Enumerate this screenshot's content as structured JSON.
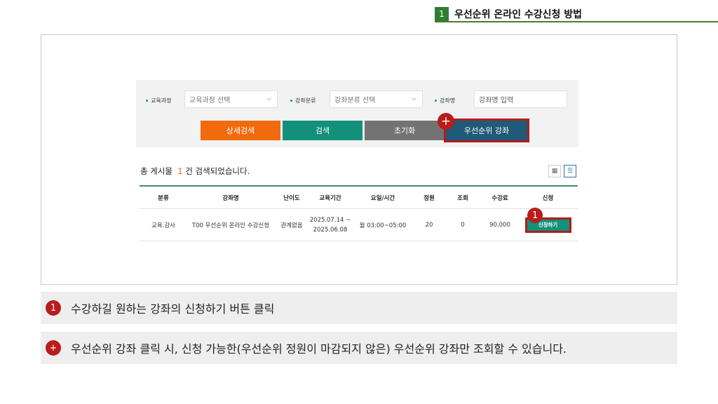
{
  "header": {
    "number": "1",
    "title": "우선순위 온라인 수강신청 방법"
  },
  "search": {
    "course_label": "교육과정",
    "course_value": "교육과정 선택",
    "category_label": "강좌분류",
    "category_value": "강좌분류 선택",
    "name_label": "강좌명",
    "name_placeholder": "강좌명 입력",
    "buttons": {
      "detail": "상세검색",
      "search": "검색",
      "reset": "초기화",
      "priority": "우선순위 강좌"
    }
  },
  "badges": {
    "plus": "+",
    "one": "1"
  },
  "result": {
    "prefix": "총 게시물",
    "count": "1",
    "suffix": "건 검색되었습니다."
  },
  "table": {
    "headers": [
      "분류",
      "강좌명",
      "난이도",
      "교육기간",
      "요일/시간",
      "정원",
      "조회",
      "수강료",
      "신청"
    ],
    "rows": [
      {
        "category": "교육.강사",
        "name": "T00 우선순위 온라인 수강신청",
        "level": "관계없음",
        "period_start": "2025.07.14 ~",
        "period_end": "2025.06.08",
        "schedule": "월 03:00~05:00",
        "capacity": "20",
        "views": "0",
        "fee": "90,000",
        "apply": "신청하기"
      }
    ]
  },
  "notes": [
    {
      "badge": "1",
      "text": "수강하길 원하는 강좌의 신청하기 버튼 클릭"
    },
    {
      "badge": "+",
      "text": "우선순위 강좌 클릭 시, 신청 가능한(우선순위 정원이 마감되지 않은) 우선순위 강좌만 조회할 수 있습니다."
    }
  ],
  "colors": {
    "accent_green": "#12907a",
    "orange": "#f26a0e",
    "highlight_red": "#b31b1b",
    "priority_blue": "#1f5a78"
  }
}
